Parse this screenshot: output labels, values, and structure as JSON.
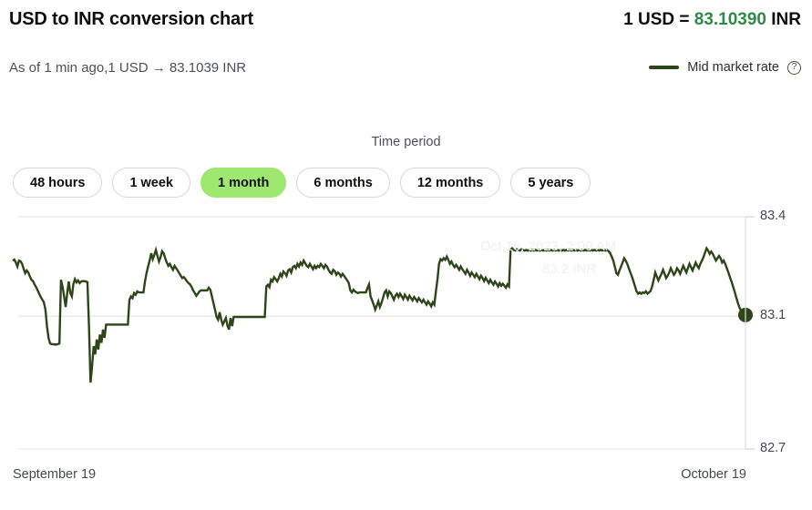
{
  "header": {
    "title": "USD to INR conversion chart",
    "rate_prefix": "1 USD = ",
    "rate_value": "83.10390",
    "rate_suffix": " INR",
    "subtitle": "As of 1 min ago,1 USD → 83.1039 INR",
    "accent_green": "#2f8a45"
  },
  "legend": {
    "swatch_icon": "line-swatch-icon",
    "label": "Mid market rate",
    "help_icon": "question-mark-icon",
    "help_glyph": "?",
    "color": "#2d4618"
  },
  "time_period": {
    "label": "Time period",
    "options": [
      {
        "label": "48 hours",
        "active": false
      },
      {
        "label": "1 week",
        "active": false
      },
      {
        "label": "1 month",
        "active": true
      },
      {
        "label": "6 months",
        "active": false
      },
      {
        "label": "12 months",
        "active": false
      },
      {
        "label": "5 years",
        "active": false
      }
    ],
    "active_color": "#9fe870"
  },
  "tooltip_ghost": {
    "line1": "Oct 16, 2023, 2:00 AM",
    "line2": "83.2 INR"
  },
  "chart_data": {
    "type": "line",
    "title": "USD to INR conversion chart",
    "xlabel": "",
    "ylabel": "",
    "series_name": "Mid market rate",
    "line_color": "#2d4618",
    "grid": true,
    "legend_position": "top-right",
    "ylim": [
      82.7,
      83.4
    ],
    "ytick_labels": [
      "83.4",
      "83.1",
      "82.7"
    ],
    "ytick_values": [
      83.4,
      83.1,
      82.7
    ],
    "x_start_label": "September 19",
    "x_end_label": "October 19",
    "end_marker": {
      "value": 83.1039,
      "visible": true
    },
    "values": [
      83.268,
      83.271,
      83.262,
      83.25,
      83.268,
      83.266,
      83.258,
      83.243,
      83.23,
      83.238,
      83.232,
      83.22,
      83.21,
      83.206,
      83.196,
      83.188,
      83.178,
      83.168,
      83.158,
      83.15,
      83.142,
      83.12,
      83.07,
      83.035,
      83.018,
      83.016,
      83.016,
      83.015,
      83.015,
      83.016,
      83.018,
      83.21,
      83.19,
      83.16,
      83.128,
      83.17,
      83.205,
      83.17,
      83.16,
      83.198,
      83.212,
      83.202,
      83.208,
      83.2,
      83.205,
      83.206,
      83.206,
      83.205,
      83.203,
      83.07,
      82.9,
      82.95,
      83.01,
      82.985,
      83.03,
      83.0,
      83.045,
      83.02,
      83.06,
      83.035,
      83.075,
      83.075,
      83.075,
      83.075,
      83.075,
      83.075,
      83.075,
      83.075,
      83.075,
      83.075,
      83.075,
      83.075,
      83.075,
      83.075,
      83.075,
      83.15,
      83.16,
      83.155,
      83.17,
      83.165,
      83.175,
      83.172,
      83.172,
      83.172,
      83.172,
      83.205,
      83.23,
      83.25,
      83.268,
      83.29,
      83.272,
      83.285,
      83.3,
      83.282,
      83.265,
      83.278,
      83.296,
      83.29,
      83.275,
      83.262,
      83.252,
      83.258,
      83.248,
      83.24,
      83.252,
      83.245,
      83.238,
      83.23,
      83.222,
      83.215,
      83.218,
      83.212,
      83.205,
      83.2,
      83.196,
      83.188,
      83.178,
      83.17,
      83.162,
      83.168,
      83.175,
      83.178,
      83.178,
      83.178,
      83.178,
      83.178,
      83.186,
      83.18,
      83.16,
      83.14,
      83.12,
      83.098,
      83.09,
      83.112,
      83.09,
      83.075,
      83.085,
      83.095,
      83.072,
      83.06,
      83.095,
      83.07,
      83.098,
      83.098,
      83.098,
      83.098,
      83.098,
      83.098,
      83.098,
      83.098,
      83.098,
      83.098,
      83.098,
      83.098,
      83.098,
      83.098,
      83.098,
      83.098,
      83.098,
      83.098,
      83.098,
      83.098,
      83.098,
      83.19,
      83.195,
      83.188,
      83.21,
      83.205,
      83.218,
      83.212,
      83.205,
      83.215,
      83.228,
      83.22,
      83.235,
      83.23,
      83.222,
      83.238,
      83.242,
      83.232,
      83.248,
      83.252,
      83.245,
      83.258,
      83.25,
      83.262,
      83.255,
      83.268,
      83.26,
      83.252,
      83.248,
      83.258,
      83.25,
      83.242,
      83.252,
      83.245,
      83.252,
      83.248,
      83.258,
      83.252,
      83.245,
      83.255,
      83.25,
      83.24,
      83.232,
      83.228,
      83.24,
      83.236,
      83.225,
      83.232,
      83.228,
      83.22,
      83.228,
      83.222,
      83.215,
      83.208,
      83.2,
      83.178,
      83.172,
      83.18,
      83.175,
      83.172,
      83.17,
      83.172,
      83.172,
      83.172,
      83.172,
      83.172,
      83.185,
      83.196,
      83.16,
      83.148,
      83.135,
      83.12,
      83.132,
      83.145,
      83.128,
      83.14,
      83.155,
      83.172,
      83.178,
      83.16,
      83.175,
      83.17,
      83.16,
      83.15,
      83.162,
      83.168,
      83.158,
      83.168,
      83.16,
      83.152,
      83.165,
      83.158,
      83.15,
      83.162,
      83.155,
      83.148,
      83.158,
      83.152,
      83.145,
      83.155,
      83.148,
      83.142,
      83.15,
      83.142,
      83.135,
      83.145,
      83.138,
      83.13,
      83.142,
      83.135,
      83.175,
      83.21,
      83.258,
      83.272,
      83.268,
      83.275,
      83.27,
      83.28,
      83.27,
      83.258,
      83.265,
      83.255,
      83.248,
      83.255,
      83.248,
      83.24,
      83.25,
      83.242,
      83.235,
      83.228,
      83.24,
      83.232,
      83.222,
      83.232,
      83.225,
      83.218,
      83.228,
      83.22,
      83.212,
      83.222,
      83.215,
      83.206,
      83.216,
      83.208,
      83.2,
      83.21,
      83.202,
      83.195,
      83.205,
      83.198,
      83.19,
      83.2,
      83.192,
      83.198,
      83.192,
      83.186,
      83.196,
      83.19,
      83.3,
      83.305,
      83.3,
      83.298,
      83.302,
      83.3,
      83.298,
      83.302,
      83.3,
      83.298,
      83.3,
      83.298,
      83.3,
      83.298,
      83.3,
      83.298,
      83.3,
      83.298,
      83.3,
      83.298,
      83.3,
      83.298,
      83.3,
      83.298,
      83.3,
      83.298,
      83.3,
      83.298,
      83.3,
      83.298,
      83.3,
      83.298,
      83.3,
      83.298,
      83.3,
      83.298,
      83.3,
      83.298,
      83.3,
      83.298,
      83.3,
      83.298,
      83.3,
      83.298,
      83.3,
      83.298,
      83.3,
      83.298,
      83.3,
      83.298,
      83.3,
      83.298,
      83.3,
      83.298,
      83.3,
      83.298,
      83.3,
      83.298,
      83.3,
      83.298,
      83.3,
      83.298,
      83.3,
      83.296,
      83.29,
      83.28,
      83.268,
      83.25,
      83.23,
      83.225,
      83.238,
      83.25,
      83.262,
      83.275,
      83.268,
      83.258,
      83.245,
      83.232,
      83.22,
      83.205,
      83.19,
      83.175,
      83.168,
      83.172,
      83.168,
      83.172,
      83.17,
      83.175,
      83.168,
      83.172,
      83.176,
      83.19,
      83.21,
      83.232,
      83.22,
      83.208,
      83.218,
      83.228,
      83.24,
      83.228,
      83.215,
      83.222,
      83.232,
      83.245,
      83.235,
      83.225,
      83.232,
      83.245,
      83.238,
      83.228,
      83.24,
      83.252,
      83.242,
      83.232,
      83.245,
      83.258,
      83.248,
      83.238,
      83.25,
      83.262,
      83.252,
      83.245,
      83.258,
      83.268,
      83.278,
      83.292,
      83.305,
      83.298,
      83.288,
      83.295,
      83.288,
      83.278,
      83.268,
      83.275,
      83.282,
      83.275,
      83.262,
      83.268,
      83.258,
      83.245,
      83.232,
      83.218,
      83.205,
      83.19,
      83.175,
      83.158,
      83.142,
      83.128,
      83.118,
      83.11,
      83.105,
      83.104
    ]
  }
}
